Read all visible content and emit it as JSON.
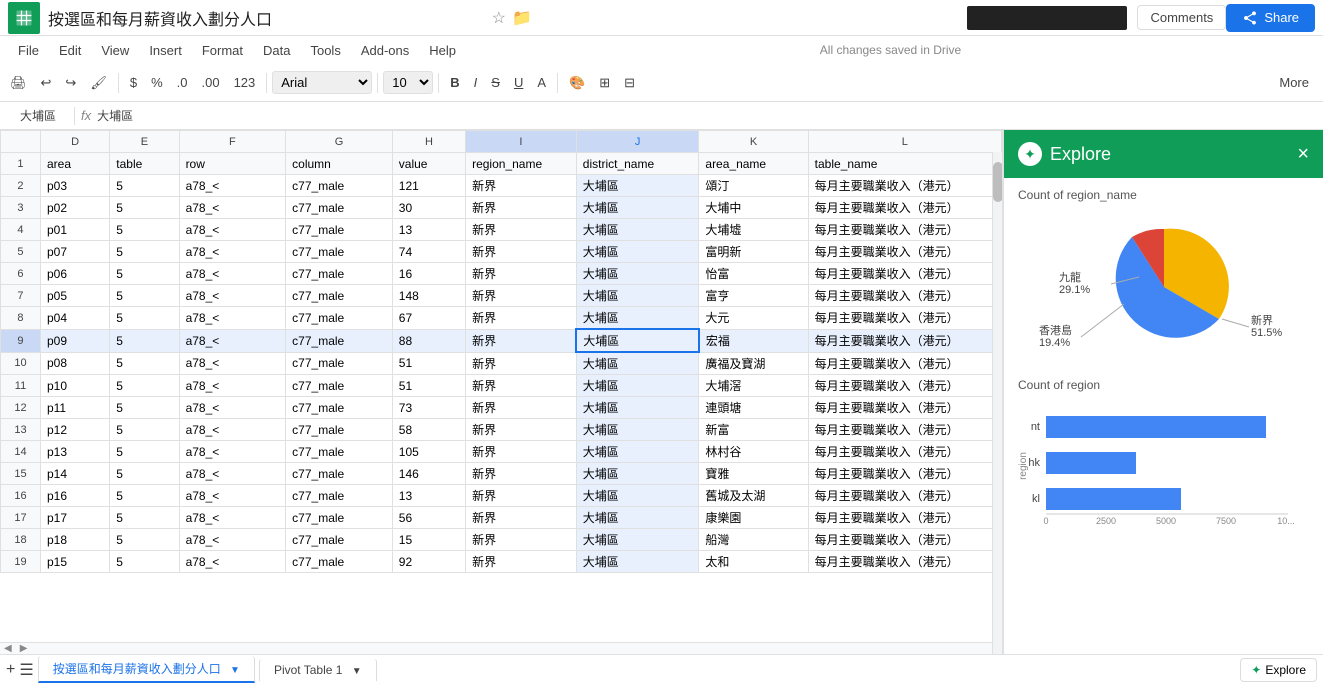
{
  "app": {
    "title": "按選區和每月薪資收入劃分人口",
    "icon": "sheets-icon",
    "cloud_status": "All changes saved in Drive",
    "comments_label": "Comments",
    "share_label": "Share"
  },
  "menu": {
    "items": [
      "File",
      "Edit",
      "View",
      "Insert",
      "Format",
      "Data",
      "Tools",
      "Add-ons",
      "Help"
    ]
  },
  "toolbar": {
    "more_label": "More",
    "font": "Arial",
    "size": "10",
    "bold": "B",
    "italic": "I",
    "strikethrough": "S",
    "underline": "U"
  },
  "formula_bar": {
    "cell_ref": "大埔區",
    "fx": "fx",
    "formula": "大埔區"
  },
  "columns": {
    "headers": [
      "D",
      "E",
      "F",
      "G",
      "H",
      "I",
      "J",
      "K",
      "L"
    ]
  },
  "table": {
    "row1": [
      "area",
      "table",
      "row",
      "column",
      "value",
      "region_name",
      "district_name",
      "area_name",
      "table_name"
    ],
    "rows": [
      [
        "p03",
        "5",
        "a78_<",
        "c77_male",
        "121",
        "新界",
        "大埔區",
        "頌汀",
        "每月主要職業收入（港元）"
      ],
      [
        "p02",
        "5",
        "a78_<",
        "c77_male",
        "30",
        "新界",
        "大埔區",
        "大埔中",
        "每月主要職業收入（港元）"
      ],
      [
        "p01",
        "5",
        "a78_<",
        "c77_male",
        "13",
        "新界",
        "大埔區",
        "大埔墟",
        "每月主要職業收入（港元）"
      ],
      [
        "p07",
        "5",
        "a78_<",
        "c77_male",
        "74",
        "新界",
        "大埔區",
        "富明新",
        "每月主要職業收入（港元）"
      ],
      [
        "p06",
        "5",
        "a78_<",
        "c77_male",
        "16",
        "新界",
        "大埔區",
        "怡富",
        "每月主要職業收入（港元）"
      ],
      [
        "p05",
        "5",
        "a78_<",
        "c77_male",
        "148",
        "新界",
        "大埔區",
        "富亨",
        "每月主要職業收入（港元）"
      ],
      [
        "p04",
        "5",
        "a78_<",
        "c77_male",
        "67",
        "新界",
        "大埔區",
        "大元",
        "每月主要職業收入（港元）"
      ],
      [
        "p09",
        "5",
        "a78_<",
        "c77_male",
        "88",
        "新界",
        "大埔區",
        "宏福",
        "每月主要職業收入（港元）"
      ],
      [
        "p08",
        "5",
        "a78_<",
        "c77_male",
        "51",
        "新界",
        "大埔區",
        "廣福及寶湖",
        "每月主要職業收入（港元）"
      ],
      [
        "p10",
        "5",
        "a78_<",
        "c77_male",
        "51",
        "新界",
        "大埔區",
        "大埔滘",
        "每月主要職業收入（港元）"
      ],
      [
        "p11",
        "5",
        "a78_<",
        "c77_male",
        "73",
        "新界",
        "大埔區",
        "連頭塘",
        "每月主要職業收入（港元）"
      ],
      [
        "p12",
        "5",
        "a78_<",
        "c77_male",
        "58",
        "新界",
        "大埔區",
        "新富",
        "每月主要職業收入（港元）"
      ],
      [
        "p13",
        "5",
        "a78_<",
        "c77_male",
        "105",
        "新界",
        "大埔區",
        "林村谷",
        "每月主要職業收入（港元）"
      ],
      [
        "p14",
        "5",
        "a78_<",
        "c77_male",
        "146",
        "新界",
        "大埔區",
        "寶雅",
        "每月主要職業收入（港元）"
      ],
      [
        "p16",
        "5",
        "a78_<",
        "c77_male",
        "13",
        "新界",
        "大埔區",
        "舊城及太湖",
        "每月主要職業收入（港元）"
      ],
      [
        "p17",
        "5",
        "a78_<",
        "c77_male",
        "56",
        "新界",
        "大埔區",
        "康樂園",
        "每月主要職業收入（港元）"
      ],
      [
        "p18",
        "5",
        "a78_<",
        "c77_male",
        "15",
        "新界",
        "大埔區",
        "船灣",
        "每月主要職業收入（港元）"
      ],
      [
        "p15",
        "5",
        "a78_<",
        "c77_male",
        "92",
        "新界",
        "大埔區",
        "太和",
        "每月主要職業收入（港元）"
      ]
    ],
    "selected_row": 9,
    "selected_col": "J"
  },
  "row_numbers": [
    1,
    2,
    3,
    4,
    5,
    6,
    7,
    8,
    9,
    10,
    11,
    12,
    13,
    14,
    15,
    16,
    17,
    18,
    19
  ],
  "explore": {
    "title": "Explore",
    "close": "×",
    "chart1_title": "Count of region_name",
    "chart2_title": "Count of region",
    "pie_data": [
      {
        "label": "九龍",
        "pct": "29.1%",
        "color": "#f4b400",
        "startAngle": 0,
        "endAngle": 104.76
      },
      {
        "label": "新界",
        "pct": "51.5%",
        "color": "#4285f4",
        "startAngle": 104.76,
        "endAngle": 290.16
      },
      {
        "label": "香港島",
        "pct": "19.4%",
        "color": "#db4437",
        "startAngle": 290.16,
        "endAngle": 360
      }
    ],
    "bar_data": [
      {
        "label": "nt",
        "value": 9200,
        "color": "#4285f4"
      },
      {
        "label": "hk",
        "value": 3500,
        "color": "#4285f4"
      },
      {
        "label": "kl",
        "value": 5200,
        "color": "#4285f4"
      }
    ],
    "bar_x_labels": [
      "0",
      "2500",
      "5000",
      "7500",
      "10"
    ],
    "x_axis_label": "region"
  },
  "bottom": {
    "sheet1_label": "按選區和每月薪資收入劃分人口",
    "sheet2_label": "Pivot Table 1",
    "add_sheet": "+",
    "sheet_menu": "☰",
    "explore_btn": "Explore"
  }
}
